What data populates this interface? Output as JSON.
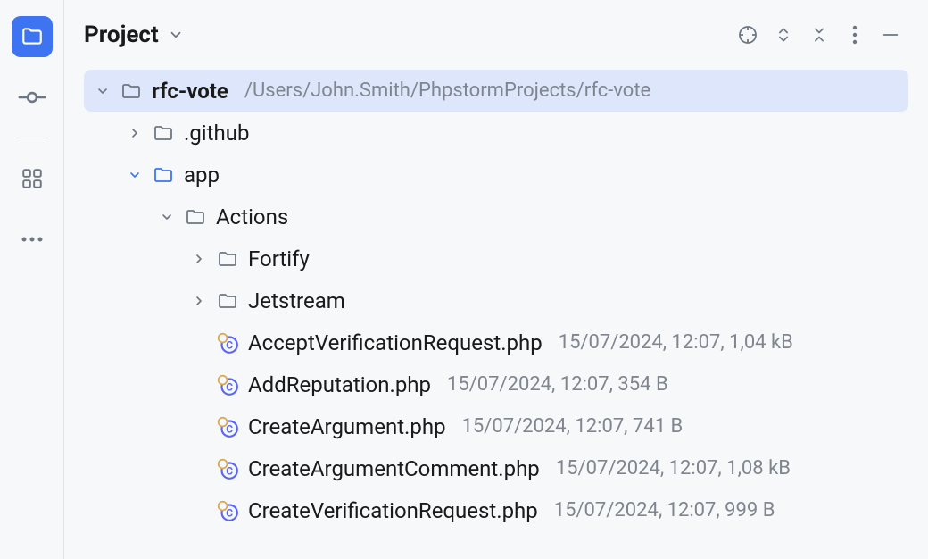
{
  "panel": {
    "title": "Project"
  },
  "tree": {
    "root": {
      "name": "rfc-vote",
      "path": "/Users/John.Smith/PhpstormProjects/rfc-vote"
    },
    "github": {
      "name": ".github"
    },
    "app": {
      "name": "app"
    },
    "actions": {
      "name": "Actions"
    },
    "fortify": {
      "name": "Fortify"
    },
    "jetstream": {
      "name": "Jetstream"
    },
    "files": {
      "f1": {
        "name": "AcceptVerificationRequest.php",
        "meta": "15/07/2024, 12:07, 1,04 kB"
      },
      "f2": {
        "name": "AddReputation.php",
        "meta": "15/07/2024, 12:07, 354 B"
      },
      "f3": {
        "name": "CreateArgument.php",
        "meta": "15/07/2024, 12:07, 741 B"
      },
      "f4": {
        "name": "CreateArgumentComment.php",
        "meta": "15/07/2024, 12:07, 1,08 kB"
      },
      "f5": {
        "name": "CreateVerificationRequest.php",
        "meta": "15/07/2024, 12:07, 999 B"
      }
    }
  }
}
